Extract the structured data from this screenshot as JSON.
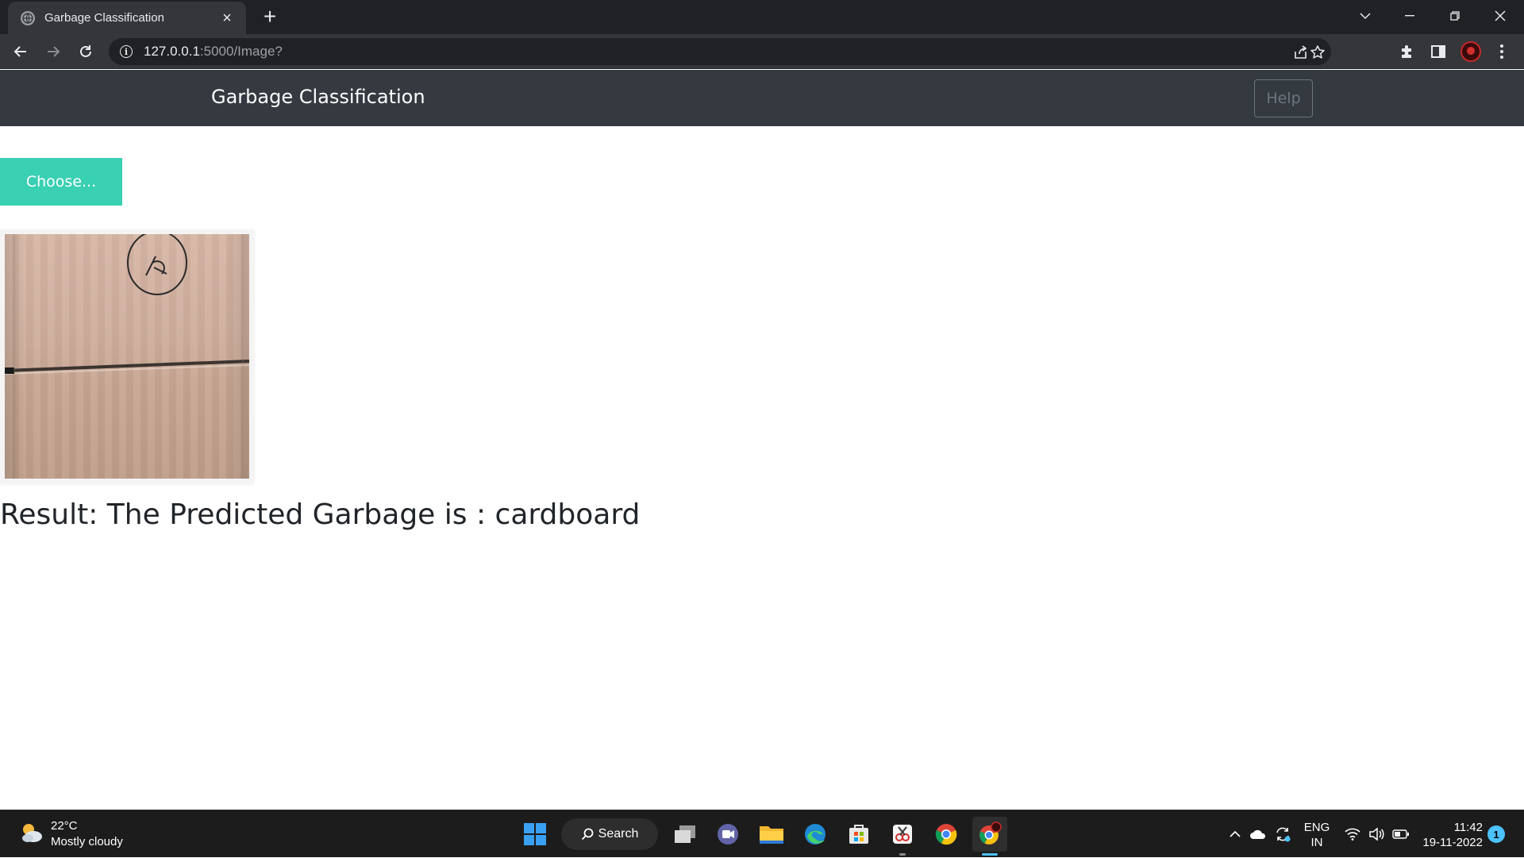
{
  "browser": {
    "tab_title": "Garbage Classification",
    "tab_close": "×",
    "new_tab": "+",
    "url_host": "127.0.0.1",
    "url_rest": ":5000/Image?"
  },
  "page": {
    "brand": "Garbage Classification",
    "help_label": "Help",
    "choose_label": "Choose...",
    "result_text": "Result: The Predicted Garbage is : cardboard"
  },
  "taskbar": {
    "weather_temp": "22°C",
    "weather_desc": "Mostly cloudy",
    "search_label": "Search",
    "lang_primary": "ENG",
    "lang_region": "IN",
    "time": "11:42",
    "date": "19-11-2022",
    "notification_count": "1"
  },
  "colors": {
    "navbar": "#343a40",
    "choose_button": "#39d0b3",
    "result_text": "#212529"
  }
}
